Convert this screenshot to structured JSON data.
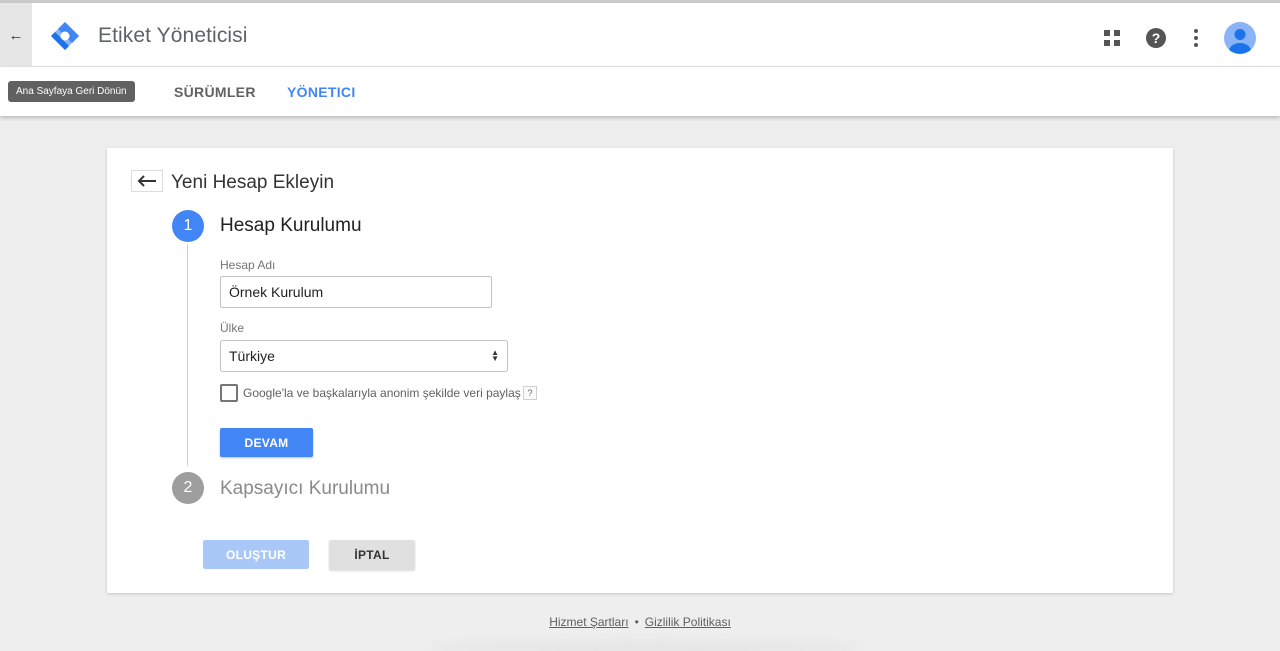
{
  "header": {
    "app_title": "Etiket Yöneticisi",
    "back_tooltip": "Ana Sayfaya Geri Dönün",
    "icons": [
      "back-arrow-icon",
      "tag-manager-logo",
      "apps-grid-icon",
      "help-icon",
      "more-vert-icon",
      "account-avatar-icon"
    ]
  },
  "tabs": [
    {
      "label": "SÜRÜMLER",
      "active": false
    },
    {
      "label": "YÖNETICI",
      "active": true
    }
  ],
  "card": {
    "title": "Yeni Hesap Ekleyin",
    "step1": {
      "number": "1",
      "title": "Hesap Kurulumu",
      "account_name_label": "Hesap Adı",
      "account_name_value": "Örnek Kurulum",
      "country_label": "Ülke",
      "country_value": "Türkiye",
      "share_data_label": "Google'la ve başkalarıyla anonim şekilde veri paylaş",
      "share_data_checked": false,
      "help_mark": "?",
      "continue_label": "DEVAM"
    },
    "step2": {
      "number": "2",
      "title": "Kapsayıcı Kurulumu"
    },
    "create_label": "OLUŞTUR",
    "cancel_label": "İPTAL"
  },
  "footer": {
    "terms": "Hizmet Şartları",
    "separator": "•",
    "privacy": "Gizlilik Politikası"
  },
  "colors": {
    "accent": "#4285f4",
    "disabled_accent": "#a9c8f7",
    "logo_dark": "#1a73e8",
    "logo_light": "#8ab4f8"
  }
}
